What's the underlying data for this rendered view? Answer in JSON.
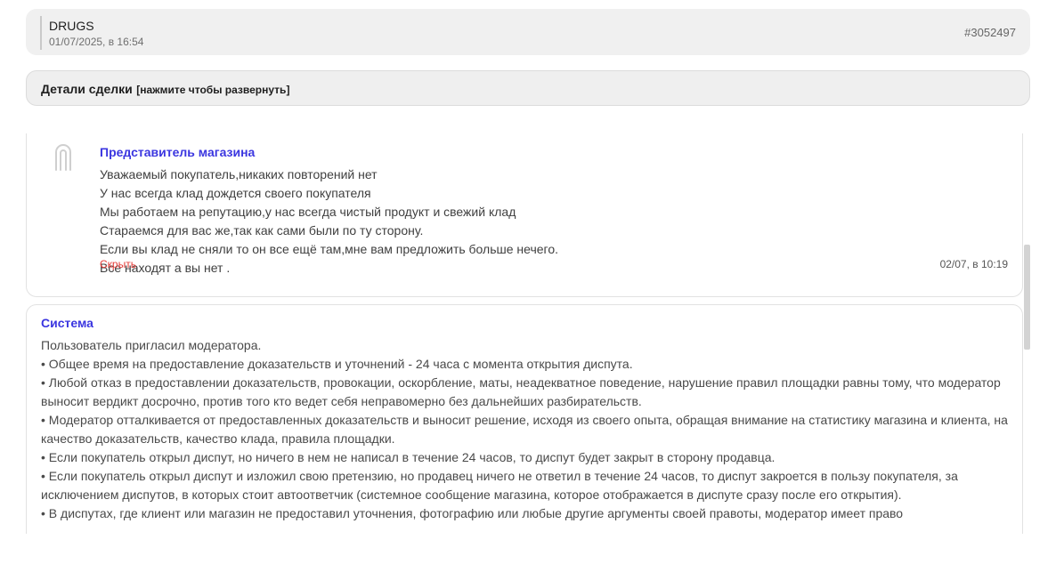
{
  "header": {
    "title": "DRUGS",
    "date": "01/07/2025, в 16:54",
    "order_id": "#3052497"
  },
  "details": {
    "title": "Детали сделки",
    "hint": "[нажмите чтобы развернуть]"
  },
  "messages": [
    {
      "author": "Представитель магазина",
      "avatar_icon": "fingerprint-icon",
      "lines": [
        "Уважаемый покупатель,никаких повторений нет",
        "У нас всегда клад дождется своего покупателя",
        "Мы работаем на репутацию,у нас всегда чистый продукт и свежий клад",
        "Стараемся для вас же,так как сами были по ту сторону.",
        "Если вы клад не сняли то он все ещё там,мне вам предложить больше нечего.",
        "Все находят а вы нет ."
      ],
      "hide_label": "Скрыть",
      "time": "02/07, в 10:19"
    },
    {
      "author": "Система",
      "lines": [
        "Пользователь пригласил модератора.",
        "• Общее время на предоставление доказательств и уточнений - 24 часа с момента открытия диспута.",
        "• Любой отказ в предоставлении доказательств, провокации, оскорбление, маты, неадекватное поведение, нарушение правил площадки равны тому, что модератор выносит вердикт досрочно, против того кто ведет себя неправомерно без дальнейших разбирательств.",
        "• Модератор отталкивается от предоставленных доказательств и выносит решение, исходя из своего опыта, обращая внимание на статистику магазина и клиента, на качество доказательств, качество клада, правила площадки.",
        "• Если покупатель открыл диспут, но ничего в нем не написал в течение 24 часов, то диспут будет закрыт в сторону продавца.",
        "• Если покупатель открыл диспут и изложил свою претензию, но продавец ничего не ответил в течение 24 часов, то диспут закроется в пользу покупателя, за исключением диспутов, в которых стоит автоответчик (системное сообщение магазина, которое отображается в диспуте сразу после его открытия).",
        "• В диспутах, где клиент или магазин не предоставил уточнения, фотографию или любые другие аргументы своей правоты, модератор имеет право"
      ]
    }
  ],
  "colors": {
    "author": "#3b36e0",
    "hide_link": "#e53935",
    "card_bg": "#f0f0f0"
  }
}
